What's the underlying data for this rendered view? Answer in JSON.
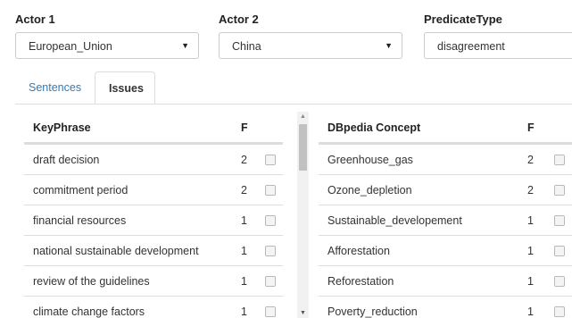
{
  "filters": {
    "actor1": {
      "label": "Actor 1",
      "value": "European_Union"
    },
    "actor2": {
      "label": "Actor 2",
      "value": "China"
    },
    "predicate_type": {
      "label": "PredicateType",
      "value": "disagreement"
    }
  },
  "tabs": [
    {
      "label": "Sentences",
      "active": false
    },
    {
      "label": "Issues",
      "active": true
    }
  ],
  "keyphrase_table": {
    "headers": [
      "KeyPhrase",
      "F"
    ],
    "rows": [
      {
        "phrase": "draft decision",
        "f": "2"
      },
      {
        "phrase": "commitment period",
        "f": "2"
      },
      {
        "phrase": "financial resources",
        "f": "1"
      },
      {
        "phrase": "national sustainable development",
        "f": "1"
      },
      {
        "phrase": "review of the guidelines",
        "f": "1"
      },
      {
        "phrase": "climate change factors",
        "f": "1"
      }
    ]
  },
  "dbpedia_table": {
    "headers": [
      "DBpedia Concept",
      "F"
    ],
    "rows": [
      {
        "concept": "Greenhouse_gas",
        "f": "2"
      },
      {
        "concept": "Ozone_depletion",
        "f": "2"
      },
      {
        "concept": "Sustainable_developement",
        "f": "1"
      },
      {
        "concept": "Afforestation",
        "f": "1"
      },
      {
        "concept": "Reforestation",
        "f": "1"
      },
      {
        "concept": "Poverty_reduction",
        "f": "1"
      }
    ]
  },
  "icons": {
    "dropdown": "caret-down-icon",
    "scroll_up": "arrow-up-icon",
    "scroll_down": "arrow-down-icon"
  },
  "colors": {
    "link": "#337ab7",
    "border": "#dddddd"
  }
}
